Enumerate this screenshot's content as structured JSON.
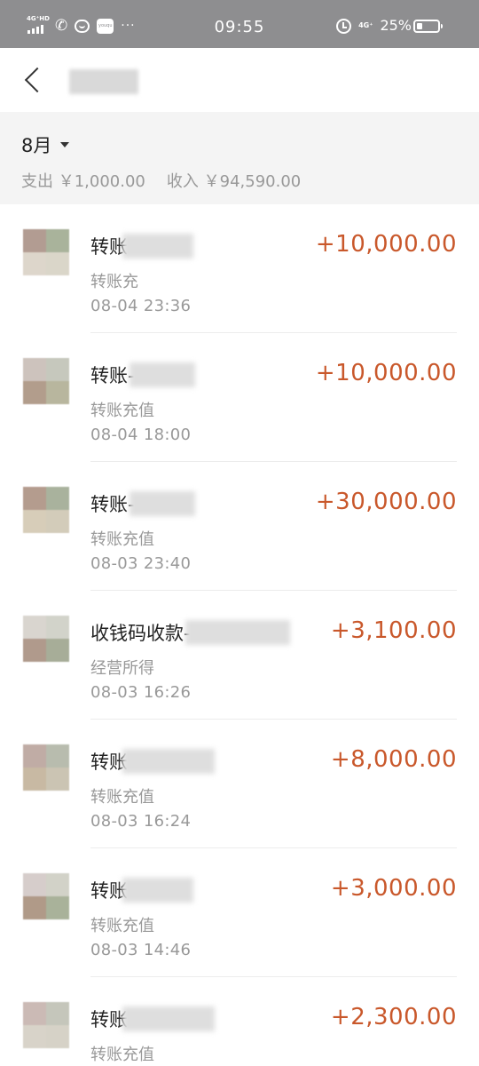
{
  "status_bar": {
    "network_label": "4G⁺HD",
    "network_label_right": "4G⁺",
    "time": "09:55",
    "battery_percent": "25%",
    "battery_level": 0.25,
    "app_icon_text": "youqu",
    "more_dots": "···",
    "phone_glyph": "✆",
    "icons": [
      "signal-icon",
      "phone-icon",
      "chat-icon",
      "app-icon",
      "more-icon",
      "alarm-icon",
      "battery-icon"
    ]
  },
  "nav": {
    "back_icon": "chevron-left-icon"
  },
  "summary": {
    "month": "8月",
    "expense": "支出 ￥1,000.00",
    "income": "收入 ￥94,590.00"
  },
  "colors": {
    "amount": "#c9582b",
    "status_bar_bg": "#8e8e90",
    "summary_bg": "#f4f4f4"
  },
  "transactions": [
    {
      "title": "转账",
      "subtitle": "转账充",
      "time": "08-04  23:36",
      "amount": "+10,000.00"
    },
    {
      "title": "转账-",
      "subtitle": "转账充值",
      "time": "08-04  18:00",
      "amount": "+10,000.00"
    },
    {
      "title": "转账-",
      "subtitle": "转账充值",
      "time": "08-03  23:40",
      "amount": "+30,000.00"
    },
    {
      "title": "收钱码收款-",
      "subtitle": "经营所得",
      "time": "08-03  16:26",
      "amount": "+3,100.00"
    },
    {
      "title": "转账",
      "subtitle": "转账充值",
      "time": "08-03  16:24",
      "amount": "+8,000.00"
    },
    {
      "title": "转账",
      "subtitle": "转账充值",
      "time": "08-03  14:46",
      "amount": "+3,000.00"
    },
    {
      "title": "转账",
      "subtitle": "转账充值",
      "time": "",
      "amount": "+2,300.00"
    }
  ]
}
